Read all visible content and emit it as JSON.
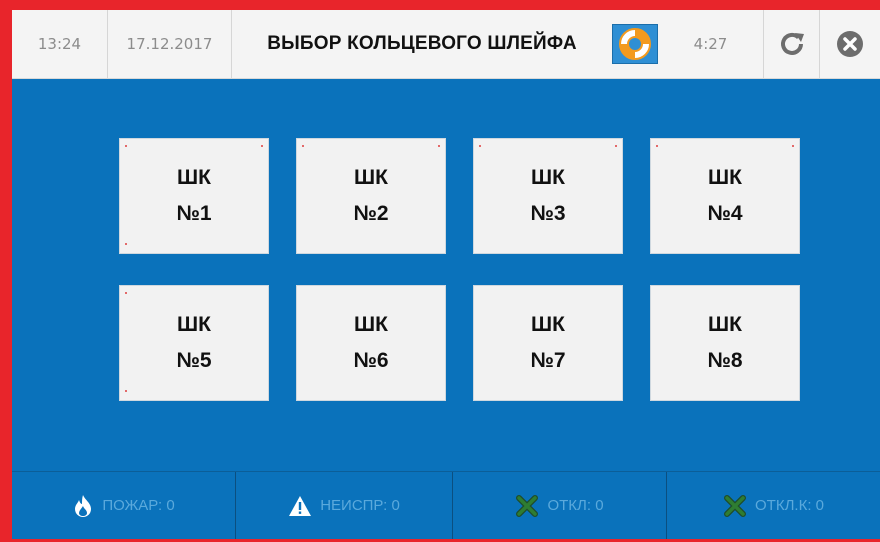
{
  "header": {
    "time": "13:24",
    "date": "17.12.2017",
    "title": "ВЫБОР КОЛЬЦЕВОГО ШЛЕЙФА",
    "help_icon": "lifebuoy-icon",
    "timer": "4:27",
    "refresh_icon": "refresh-icon",
    "close_icon": "close-circle-icon"
  },
  "loops": [
    {
      "line1": "ШК",
      "line2": "№1"
    },
    {
      "line1": "ШК",
      "line2": "№2"
    },
    {
      "line1": "ШК",
      "line2": "№3"
    },
    {
      "line1": "ШК",
      "line2": "№4"
    },
    {
      "line1": "ШК",
      "line2": "№5"
    },
    {
      "line1": "ШК",
      "line2": "№6"
    },
    {
      "line1": "ШК",
      "line2": "№7"
    },
    {
      "line1": "ШК",
      "line2": "№8"
    }
  ],
  "status": {
    "fire": "ПОЖАР: 0",
    "fault": "НЕИСПР: 0",
    "disabled": "ОТКЛ: 0",
    "disabled_k": "ОТКЛ.К: 0"
  },
  "colors": {
    "frame": "#e8252b",
    "background": "#0a72bb",
    "header": "#f4f4f4",
    "button": "#f2f2f2",
    "status_text": "#5aa9dc",
    "status_icon_green": "#2e7d32"
  }
}
